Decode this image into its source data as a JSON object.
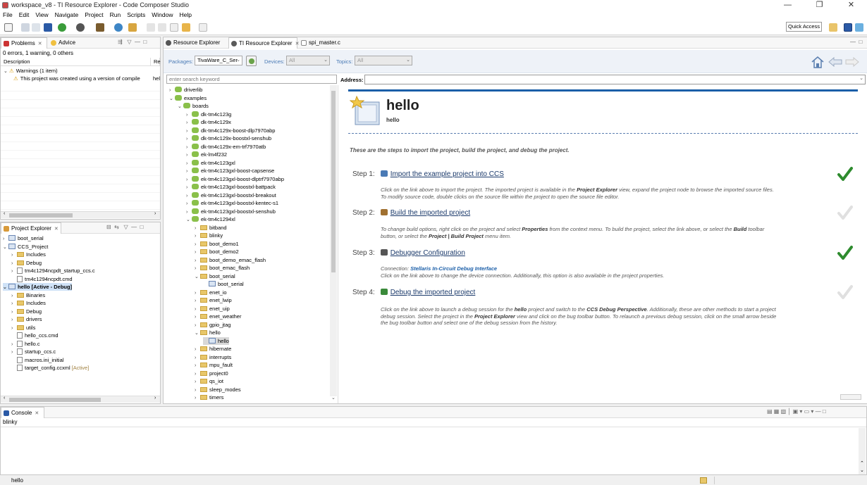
{
  "window": {
    "title": "workspace_v8 - TI Resource Explorer - Code Composer Studio",
    "minimize": "—",
    "maximize": "❐",
    "close": "✕"
  },
  "menubar": [
    "File",
    "Edit",
    "View",
    "Navigate",
    "Project",
    "Run",
    "Scripts",
    "Window",
    "Help"
  ],
  "toolbar": {
    "quick_access": "Quick Access"
  },
  "problems": {
    "tabs": [
      {
        "label": "Problems"
      },
      {
        "label": "Advice"
      }
    ],
    "summary": "0 errors, 1 warning, 0 others",
    "columns": [
      "Description",
      "Re"
    ],
    "rows": [
      {
        "label": "Warnings (1 item)"
      },
      {
        "label": "This project was created using a version of compile",
        "resource": "hel"
      }
    ]
  },
  "project_explorer": {
    "tab": "Project Explorer",
    "items": [
      {
        "label": "boot_serial",
        "depth": 0,
        "kind": "proj",
        "expand": "›"
      },
      {
        "label": "CCS_Project",
        "depth": 0,
        "kind": "proj",
        "expand": "⌄"
      },
      {
        "label": "Includes",
        "depth": 1,
        "kind": "fold",
        "expand": "›"
      },
      {
        "label": "Debug",
        "depth": 1,
        "kind": "fold",
        "expand": "›"
      },
      {
        "label": "tm4c1294ncpdt_startup_ccs.c",
        "depth": 1,
        "kind": "file",
        "expand": "›"
      },
      {
        "label": "tm4c1294ncpdt.cmd",
        "depth": 1,
        "kind": "file",
        "expand": ""
      },
      {
        "label": "hello  [Active - Debug]",
        "depth": 0,
        "kind": "proj",
        "expand": "⌄",
        "selected": true
      },
      {
        "label": "Binaries",
        "depth": 1,
        "kind": "fold",
        "expand": "›"
      },
      {
        "label": "Includes",
        "depth": 1,
        "kind": "fold",
        "expand": "›"
      },
      {
        "label": "Debug",
        "depth": 1,
        "kind": "fold",
        "expand": "›"
      },
      {
        "label": "drivers",
        "depth": 1,
        "kind": "fold",
        "expand": "›"
      },
      {
        "label": "utils",
        "depth": 1,
        "kind": "fold",
        "expand": "›"
      },
      {
        "label": "hello_ccs.cmd",
        "depth": 1,
        "kind": "file",
        "expand": ""
      },
      {
        "label": "hello.c",
        "depth": 1,
        "kind": "file",
        "expand": "›"
      },
      {
        "label": "startup_ccs.c",
        "depth": 1,
        "kind": "file",
        "expand": "›"
      },
      {
        "label": "macros.ini_initial",
        "depth": 1,
        "kind": "file",
        "expand": ""
      },
      {
        "label": "target_config.ccxml",
        "depth": 1,
        "kind": "file",
        "expand": "",
        "suffix": "[Active]"
      }
    ]
  },
  "editor_tabs": [
    {
      "label": "Resource Explorer"
    },
    {
      "label": "TI Resource Explorer"
    },
    {
      "label": "spi_master.c"
    }
  ],
  "filters": {
    "packages_label": "Packages:",
    "packages_value": "TivaWare_C_Ser",
    "devices_label": "Devices:",
    "devices_value": "All",
    "topics_label": "Topics:",
    "topics_value": "All"
  },
  "search": {
    "placeholder": "enter search keyword"
  },
  "address": {
    "label": "Address:",
    "value": ""
  },
  "resource_tree": [
    {
      "label": "driverlib",
      "depth": 0,
      "expand": "›",
      "kind": "pkg"
    },
    {
      "label": "examples",
      "depth": 0,
      "expand": "⌄",
      "kind": "pkg"
    },
    {
      "label": "boards",
      "depth": 1,
      "expand": "⌄",
      "kind": "pkg"
    },
    {
      "label": "dk-tm4c123g",
      "depth": 2,
      "expand": "›",
      "kind": "pkg"
    },
    {
      "label": "dk-tm4c129x",
      "depth": 2,
      "expand": "›",
      "kind": "pkg"
    },
    {
      "label": "dk-tm4c129x-boost-dlp7970abp",
      "depth": 2,
      "expand": "›",
      "kind": "pkg"
    },
    {
      "label": "dk-tm4c129x-boostxl-senshub",
      "depth": 2,
      "expand": "›",
      "kind": "pkg"
    },
    {
      "label": "dk-tm4c129x-em-trf7970atb",
      "depth": 2,
      "expand": "›",
      "kind": "pkg"
    },
    {
      "label": "ek-lm4f232",
      "depth": 2,
      "expand": "›",
      "kind": "pkg"
    },
    {
      "label": "ek-tm4c123gxl",
      "depth": 2,
      "expand": "›",
      "kind": "pkg"
    },
    {
      "label": "ek-tm4c123gxl-boost-capsense",
      "depth": 2,
      "expand": "›",
      "kind": "pkg"
    },
    {
      "label": "ek-tm4c123gxl-boost-dlptrf7970abp",
      "depth": 2,
      "expand": "›",
      "kind": "pkg"
    },
    {
      "label": "ek-tm4c123gxl-boostxl-battpack",
      "depth": 2,
      "expand": "›",
      "kind": "pkg"
    },
    {
      "label": "ek-tm4c123gxl-boostxl-breakout",
      "depth": 2,
      "expand": "›",
      "kind": "pkg"
    },
    {
      "label": "ek-tm4c123gxl-boostxl-kentec-s1",
      "depth": 2,
      "expand": "›",
      "kind": "pkg"
    },
    {
      "label": "ek-tm4c123gxl-boostxl-senshub",
      "depth": 2,
      "expand": "›",
      "kind": "pkg"
    },
    {
      "label": "ek-tm4c1294xl",
      "depth": 2,
      "expand": "⌄",
      "kind": "pkg"
    },
    {
      "label": "bitband",
      "depth": 3,
      "expand": "›",
      "kind": "fold"
    },
    {
      "label": "blinky",
      "depth": 3,
      "expand": "›",
      "kind": "fold"
    },
    {
      "label": "boot_demo1",
      "depth": 3,
      "expand": "›",
      "kind": "fold"
    },
    {
      "label": "boot_demo2",
      "depth": 3,
      "expand": "›",
      "kind": "fold"
    },
    {
      "label": "boot_demo_emac_flash",
      "depth": 3,
      "expand": "›",
      "kind": "fold"
    },
    {
      "label": "boot_emac_flash",
      "depth": 3,
      "expand": "›",
      "kind": "fold"
    },
    {
      "label": "boot_serial",
      "depth": 3,
      "expand": "⌄",
      "kind": "fold"
    },
    {
      "label": "boot_serial",
      "depth": 4,
      "expand": "",
      "kind": "proj"
    },
    {
      "label": "enet_io",
      "depth": 3,
      "expand": "›",
      "kind": "fold"
    },
    {
      "label": "enet_lwip",
      "depth": 3,
      "expand": "›",
      "kind": "fold"
    },
    {
      "label": "enet_uip",
      "depth": 3,
      "expand": "›",
      "kind": "fold"
    },
    {
      "label": "enet_weather",
      "depth": 3,
      "expand": "›",
      "kind": "fold"
    },
    {
      "label": "gpio_jtag",
      "depth": 3,
      "expand": "›",
      "kind": "fold"
    },
    {
      "label": "hello",
      "depth": 3,
      "expand": "⌄",
      "kind": "fold"
    },
    {
      "label": "hello",
      "depth": 4,
      "expand": "",
      "kind": "proj",
      "selected": true
    },
    {
      "label": "hibernate",
      "depth": 3,
      "expand": "›",
      "kind": "fold"
    },
    {
      "label": "interrupts",
      "depth": 3,
      "expand": "›",
      "kind": "fold"
    },
    {
      "label": "mpu_fault",
      "depth": 3,
      "expand": "›",
      "kind": "fold"
    },
    {
      "label": "project0",
      "depth": 3,
      "expand": "›",
      "kind": "fold"
    },
    {
      "label": "qs_iot",
      "depth": 3,
      "expand": "›",
      "kind": "fold"
    },
    {
      "label": "sleep_modes",
      "depth": 3,
      "expand": "›",
      "kind": "fold"
    },
    {
      "label": "timers",
      "depth": 3,
      "expand": "›",
      "kind": "fold"
    }
  ],
  "content": {
    "title": "hello",
    "subtitle": "hello",
    "intro": "These are the steps to import the project, build the project, and debug the project.",
    "steps": [
      {
        "label": "Step 1:",
        "link": "Import the example project into CCS",
        "done": true,
        "desc": [
          [
            "Click on the link above to import the project. The imported project is available in the ",
            ""
          ],
          [
            "Project Explorer",
            "b"
          ],
          [
            " view, expand the project node to browse the imported source files.",
            ""
          ],
          [
            "\nTo modify source code, double clicks on the source file within the project to open the source file editor.",
            ""
          ]
        ]
      },
      {
        "label": "Step 2:",
        "link": "Build the imported project",
        "done": false,
        "desc": [
          [
            "To change build options, right click on the project and select ",
            ""
          ],
          [
            "Properties",
            "b"
          ],
          [
            " from the context menu. To build the project, select the link above, or select the ",
            ""
          ],
          [
            "Build",
            "b"
          ],
          [
            " toolbar",
            ""
          ],
          [
            "\nbutton, or select the ",
            ""
          ],
          [
            "Project | Build Project",
            "b"
          ],
          [
            " menu item.",
            ""
          ]
        ]
      },
      {
        "label": "Step 3:",
        "link": "Debugger Configuration",
        "done": true,
        "desc": [
          [
            "Connection: ",
            ""
          ],
          [
            "Stellaris In-Circuit Debug Interface",
            "bl"
          ],
          [
            "\nClick on the link above to change the device connection. Additionally, this option is also available in the project properties.",
            ""
          ]
        ]
      },
      {
        "label": "Step 4:",
        "link": "Debug the imported project",
        "done": false,
        "desc": [
          [
            "Click on the link above to launch a debug session for the ",
            ""
          ],
          [
            "hello",
            "b"
          ],
          [
            " project and switch to the ",
            ""
          ],
          [
            "CCS Debug Perspective",
            "b"
          ],
          [
            ". Additionally, these are other methods to start a project",
            ""
          ],
          [
            "\ndebug session. Select the project in the ",
            ""
          ],
          [
            "Project Explorer",
            "b"
          ],
          [
            " view and click on the bug toolbar button. To relaunch a previous debug session, click on the small arrow beside",
            ""
          ],
          [
            "\nthe bug toolbar button and select one of the debug session from the history.",
            ""
          ]
        ]
      }
    ]
  },
  "console": {
    "tab": "Console",
    "line": "blinky"
  },
  "status": {
    "text": "hello"
  },
  "colors": {
    "accent": "#1a5ea8",
    "link": "#1b3a6b",
    "check": "#2e8b2e",
    "check_off": "#e0e0e0",
    "selection": "#cfe2f7"
  }
}
